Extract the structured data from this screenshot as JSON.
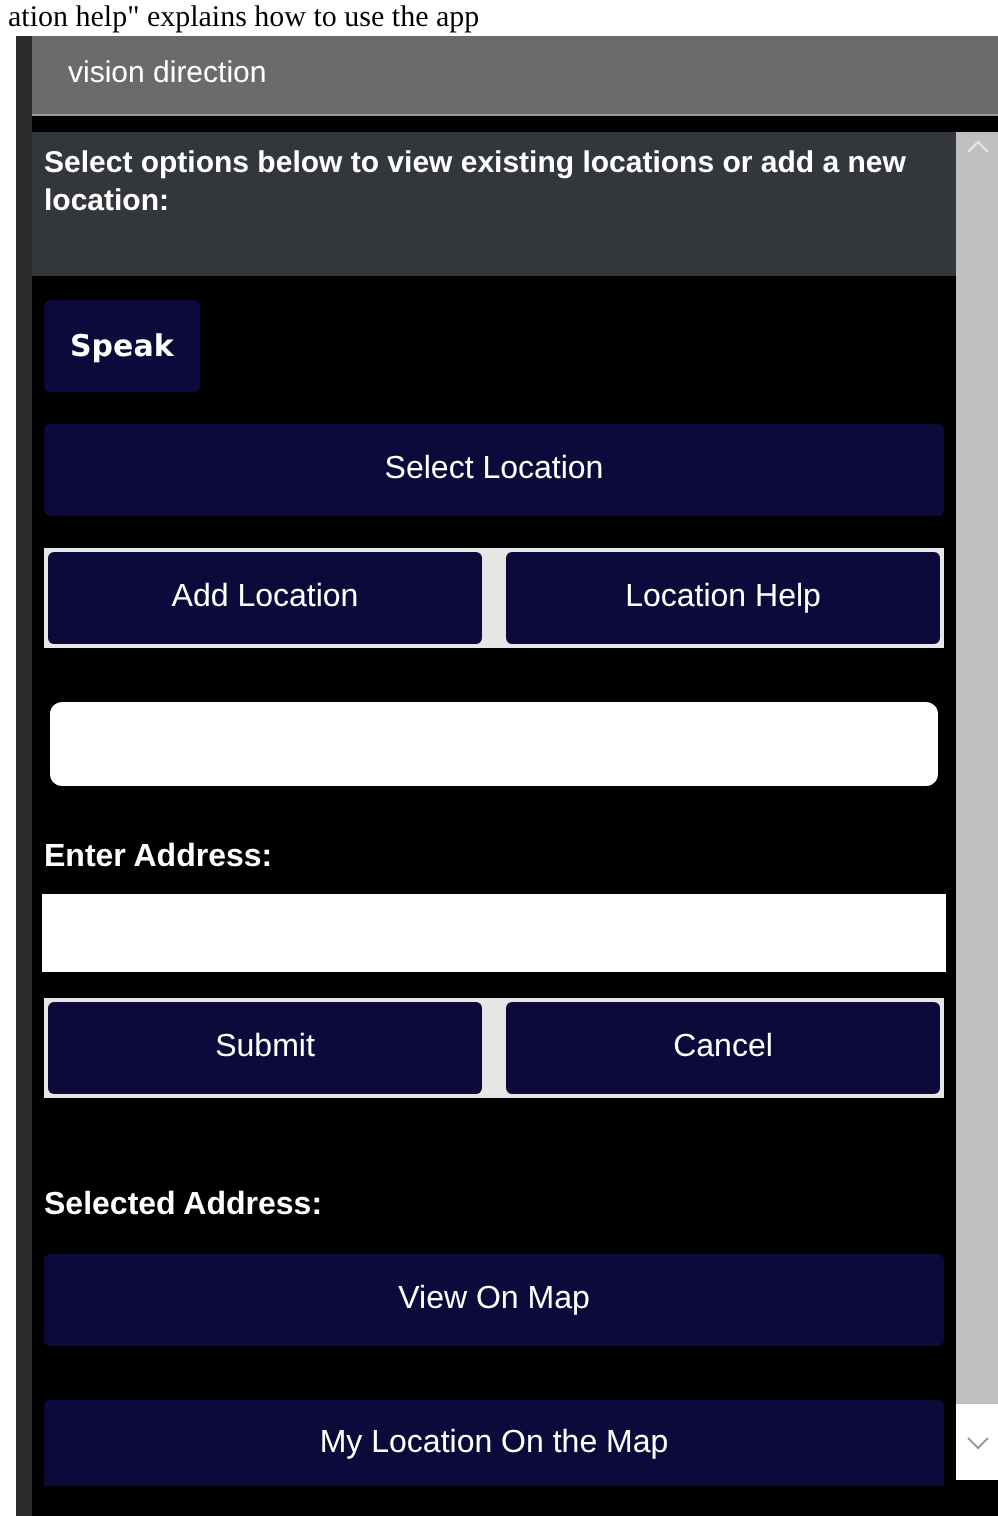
{
  "caption": "ation help\" explains how to use the app",
  "window": {
    "title": "vision direction"
  },
  "header": {
    "text": "Select options below to view existing locations or add a new location:"
  },
  "speak_button": "Speak",
  "select_button": "Select Location",
  "location_buttons": [
    "Add Location",
    "Location Help"
  ],
  "address_label": "Enter Address:",
  "form_buttons": [
    "Submit",
    "Cancel"
  ],
  "selected_label": "Selected Address:",
  "map_buttons": [
    "View On Map",
    "My Location On the Map"
  ]
}
